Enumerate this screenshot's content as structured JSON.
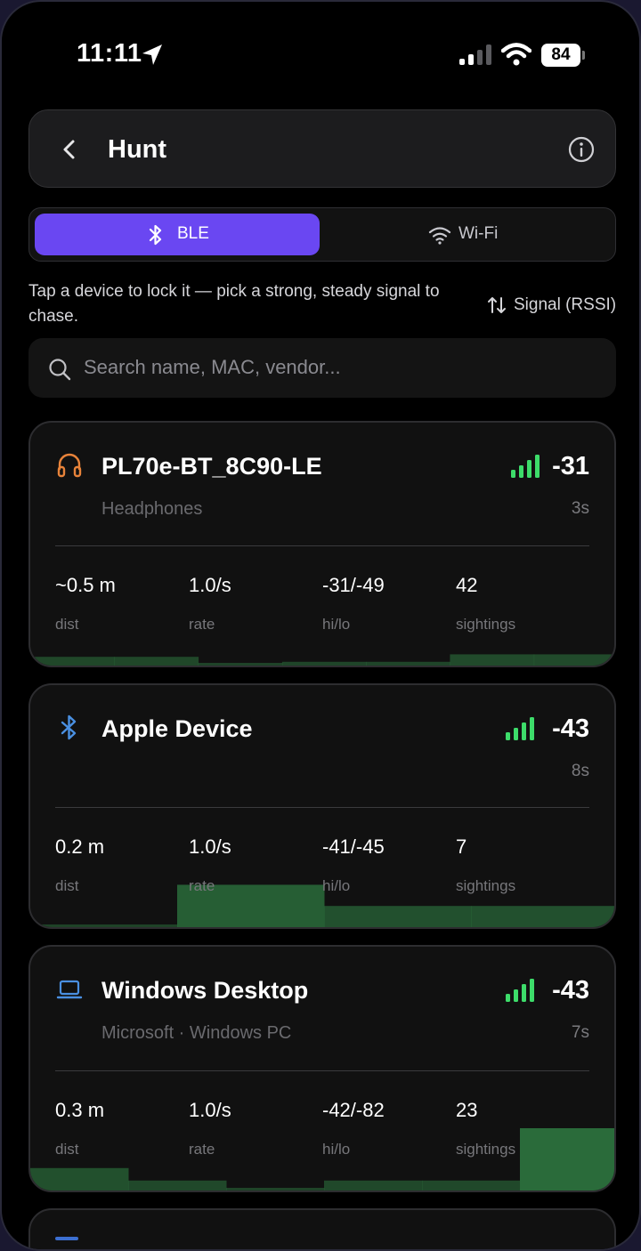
{
  "status_bar": {
    "time": "11:11",
    "battery": "84"
  },
  "header": {
    "title": "Hunt"
  },
  "tabs": [
    {
      "label": "BLE",
      "active": true
    },
    {
      "label": "Wi-Fi",
      "active": false
    }
  ],
  "hint": "Tap a device to lock it — pick a strong, steady signal to chase.",
  "sort": {
    "label": "Signal (RSSI)"
  },
  "search": {
    "placeholder": "Search name, MAC, vendor..."
  },
  "colors": {
    "accent": "#6a47f2",
    "signal": "#3ddc6a",
    "spark": "#2a6b3a"
  },
  "stat_labels": {
    "dist": "dist",
    "rate": "rate",
    "hilo": "hi/lo",
    "sightings": "sightings"
  },
  "devices": [
    {
      "icon": "headphones-icon",
      "name": "PL70e-BT_8C90-LE",
      "subtitle": "Headphones",
      "rssi": "-31",
      "age": "3s",
      "dist": "~0.5 m",
      "rate": "1.0/s",
      "hilo": "-31/-49",
      "sightings": "42",
      "history": [
        0.14,
        0.14,
        0.02,
        0.06,
        0.06,
        0.18,
        0.18
      ]
    },
    {
      "icon": "bluetooth-icon",
      "name": "Apple Device",
      "subtitle": "",
      "rssi": "-43",
      "age": "8s",
      "dist": "0.2 m",
      "rate": "1.0/s",
      "hilo": "-41/-45",
      "sightings": "7",
      "history": [
        0.0,
        0.68,
        0.34,
        0.34
      ]
    },
    {
      "icon": "laptop-icon",
      "name": "Windows Desktop",
      "subtitle": "Microsoft · Windows PC",
      "rssi": "-43",
      "age": "7s",
      "dist": "0.3 m",
      "rate": "1.0/s",
      "hilo": "-42/-82",
      "sightings": "23",
      "history": [
        0.36,
        0.16,
        0.04,
        0.16,
        0.16,
        1.0
      ]
    }
  ]
}
